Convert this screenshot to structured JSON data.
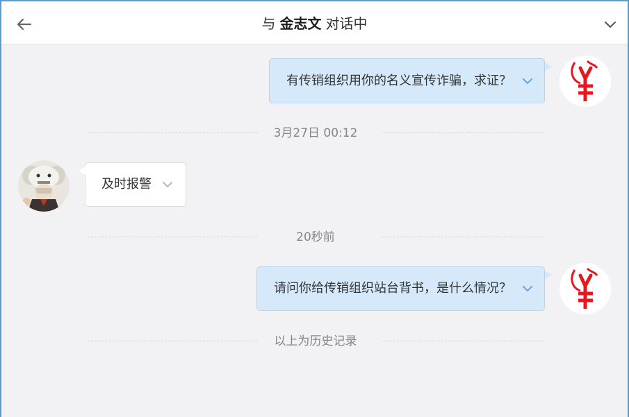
{
  "header": {
    "prefix": "与",
    "contact_name": "金志文",
    "suffix": "对话中"
  },
  "messages": [
    {
      "side": "right",
      "text": "有传销组织用你的名义宣传诈骗，求证？"
    },
    {
      "side": "left",
      "text": "及时报警"
    },
    {
      "side": "right",
      "text": "请问你给传销组织站台背书，是什么情况？"
    }
  ],
  "separators": {
    "time1": "3月27日 00:12",
    "time2": "20秒前",
    "history": "以上为历史记录"
  },
  "colors": {
    "accent_border": "#5a9bc9",
    "bubble_right_bg": "#d6e9fb",
    "bubble_left_bg": "#ffffff",
    "logo_red": "#e8171f"
  },
  "icons": {
    "back": "arrow-left-icon",
    "collapse": "chevron-down-icon",
    "message_menu": "chevron-down-icon",
    "user_avatar": "yen-logo-avatar",
    "contact_avatar": "anime-avatar"
  }
}
